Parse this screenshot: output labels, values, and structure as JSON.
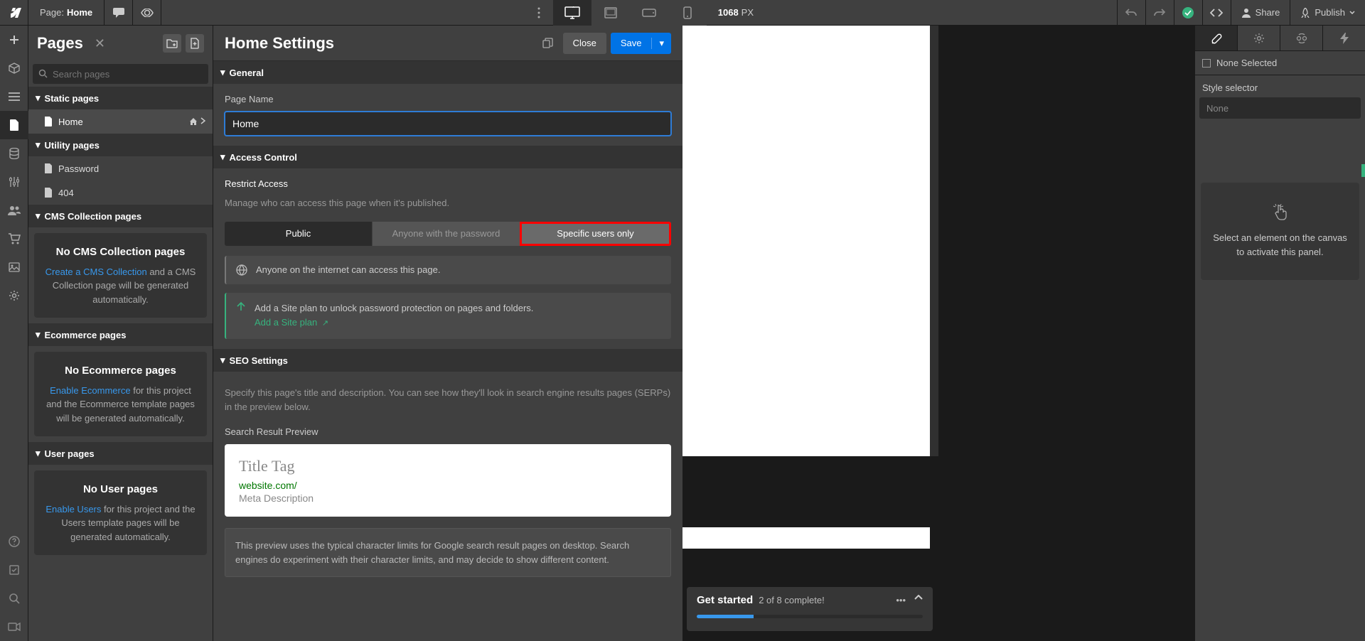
{
  "top": {
    "page_label_prefix": "Page:",
    "page_name": "Home",
    "width_value": "1068",
    "width_unit": "PX",
    "share_label": "Share",
    "publish_label": "Publish"
  },
  "pages": {
    "title": "Pages",
    "search_placeholder": "Search pages",
    "sections": {
      "static": "Static pages",
      "utility": "Utility pages",
      "cms": "CMS Collection pages",
      "ecommerce": "Ecommerce pages",
      "user": "User pages"
    },
    "items": {
      "home": "Home",
      "password": "Password",
      "notfound": "404"
    },
    "cms_empty": {
      "heading": "No CMS Collection pages",
      "link": "Create a CMS Collection",
      "rest": " and a CMS Collection page will be generated automatically."
    },
    "ecom_empty": {
      "heading": "No Ecommerce pages",
      "link": "Enable Ecommerce",
      "rest": " for this project and the Ecommerce template pages will be generated automatically."
    },
    "user_empty": {
      "heading": "No User pages",
      "link": "Enable Users",
      "rest": " for this project and the Users template pages will be generated automatically."
    }
  },
  "settings": {
    "title": "Home Settings",
    "close": "Close",
    "save": "Save",
    "general": "General",
    "page_name_label": "Page Name",
    "page_name_value": "Home",
    "access": {
      "title": "Access Control",
      "subtitle": "Restrict Access",
      "help": "Manage who can access this page when it's published.",
      "opts": {
        "public": "Public",
        "password": "Anyone with the password",
        "specific": "Specific users only"
      },
      "info": "Anyone on the internet can access this page.",
      "tip_text": "Add a Site plan to unlock password protection on pages and folders.",
      "tip_link": "Add a Site plan"
    },
    "seo": {
      "title": "SEO Settings",
      "intro": "Specify this page's title and description. You can see how they'll look in search engine results pages (SERPs) in the preview below.",
      "preview_label": "Search Result Preview",
      "serp_title": "Title Tag",
      "serp_url": "website.com/",
      "serp_desc": "Meta Description",
      "serp_foot": "This preview uses the typical character limits for Google search result pages on desktop. Search engines do experiment with their character limits, and may decide to show different content."
    }
  },
  "getstarted": {
    "title": "Get started",
    "progress": "2 of 8 complete!"
  },
  "right": {
    "none_selected": "None Selected",
    "style_sel_label": "Style selector",
    "style_sel_value": "None",
    "prompt": "Select an element on the canvas to activate this panel."
  }
}
